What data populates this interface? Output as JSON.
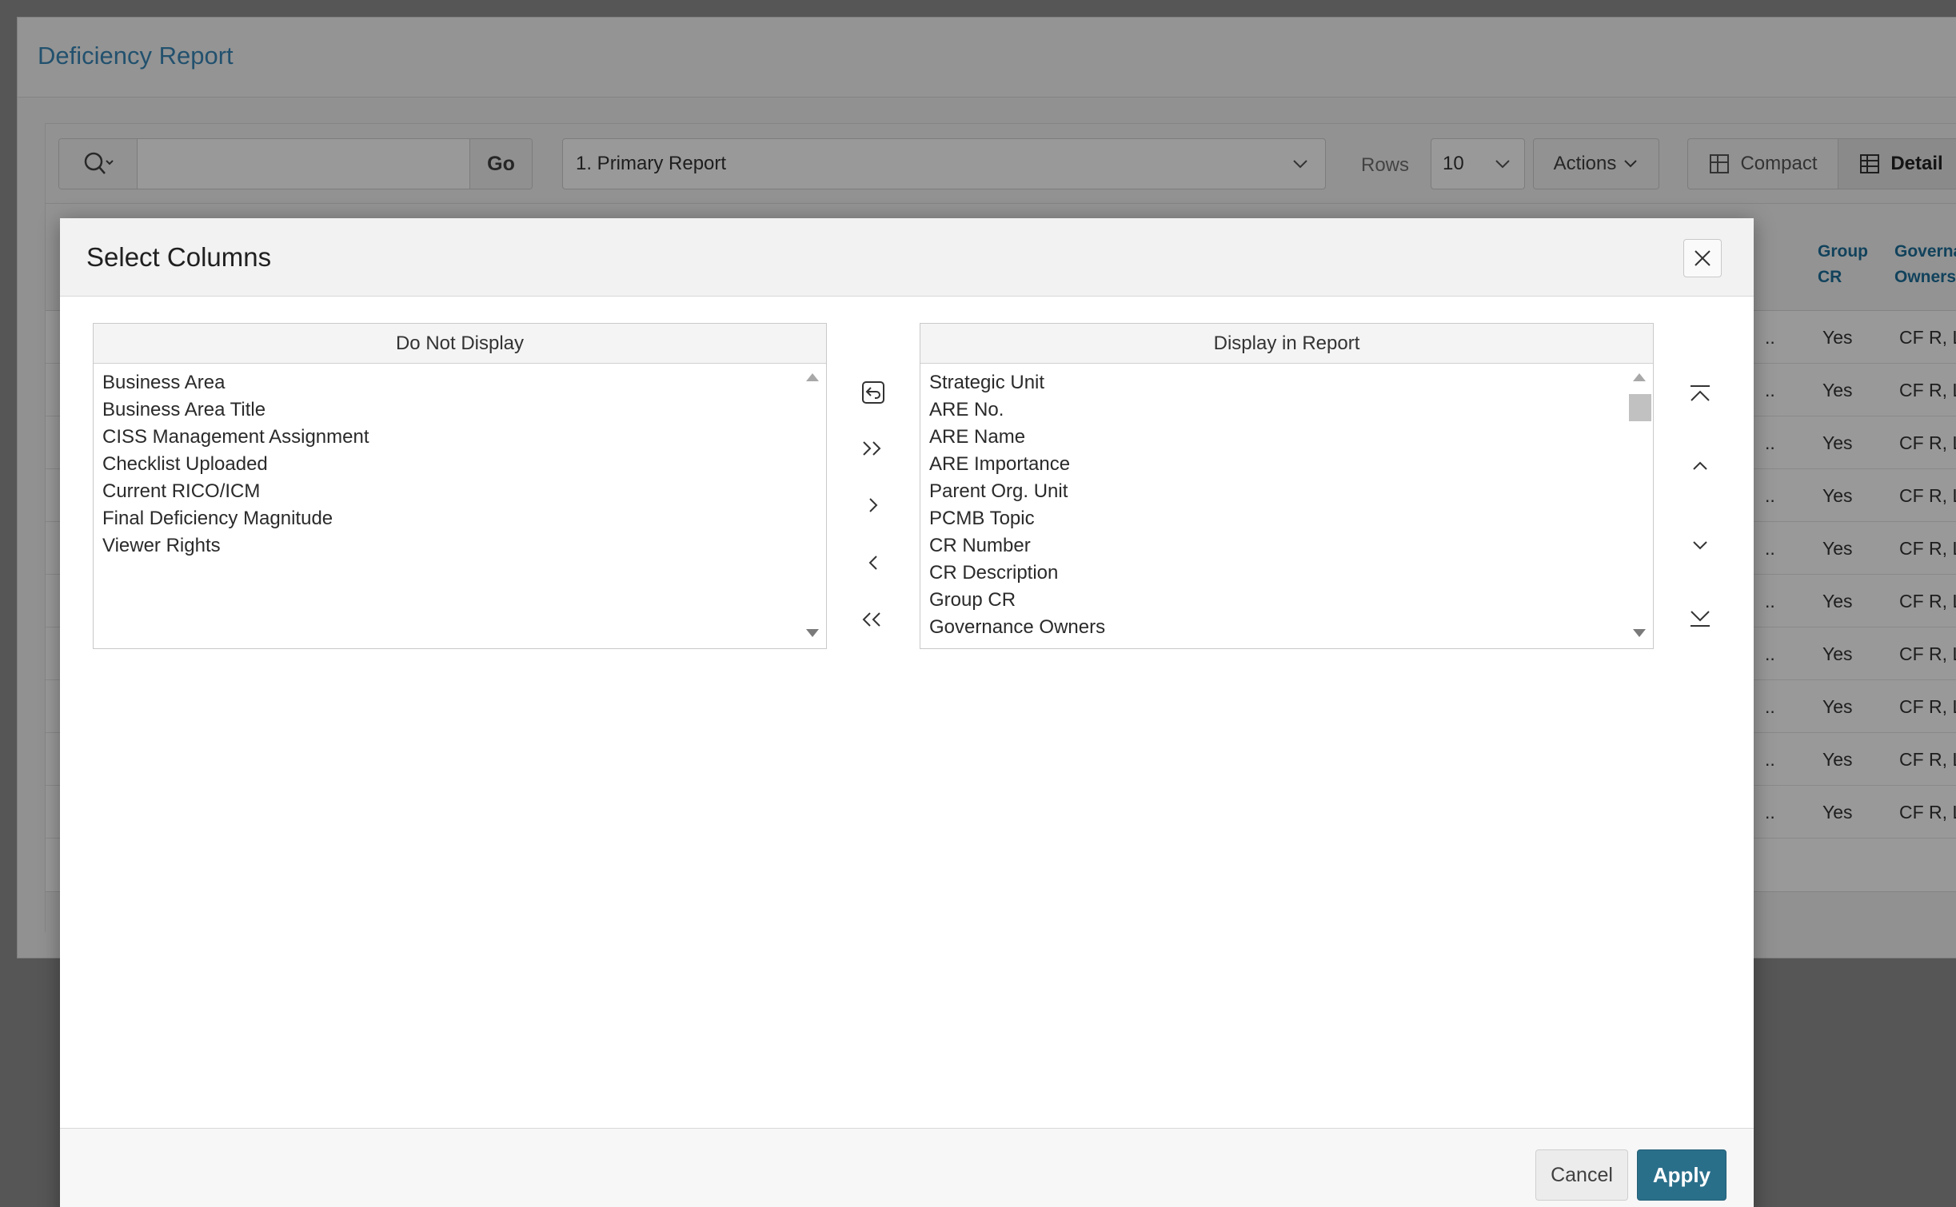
{
  "page": {
    "title": "Deficiency Report"
  },
  "toolbar": {
    "search_placeholder": "",
    "go_label": "Go",
    "report_selected": "1. Primary Report",
    "rows_label": "Rows",
    "rows_value": "10",
    "actions_label": "Actions",
    "view_compact_label": "Compact",
    "view_detail_label": "Detail"
  },
  "grid": {
    "visible_headers": [
      "Group CR",
      "Governance Owners"
    ],
    "header_group_cr": [
      "Group",
      "CR"
    ],
    "header_governance": [
      "Governance",
      "Owners"
    ],
    "rows": [
      {
        "truncated": "..",
        "group_cr": "Yes",
        "governance_owners": "CF R, LC"
      },
      {
        "truncated": "..",
        "group_cr": "Yes",
        "governance_owners": "CF R, LC"
      },
      {
        "truncated": "..",
        "group_cr": "Yes",
        "governance_owners": "CF R, LC"
      },
      {
        "truncated": "..",
        "group_cr": "Yes",
        "governance_owners": "CF R, LC"
      },
      {
        "truncated": "..",
        "group_cr": "Yes",
        "governance_owners": "CF R, LC"
      },
      {
        "truncated": "..",
        "group_cr": "Yes",
        "governance_owners": "CF R, LC"
      },
      {
        "truncated": "..",
        "group_cr": "Yes",
        "governance_owners": "CF R, LC"
      },
      {
        "truncated": "..",
        "group_cr": "Yes",
        "governance_owners": "CF R, LC"
      },
      {
        "truncated": "..",
        "group_cr": "Yes",
        "governance_owners": "CF R, LC"
      },
      {
        "truncated": "..",
        "group_cr": "Yes",
        "governance_owners": "CF R, LC"
      }
    ]
  },
  "dialog": {
    "title": "Select Columns",
    "do_not_display_header": "Do Not Display",
    "display_in_report_header": "Display in Report",
    "do_not_display_items": [
      "Business Area",
      "Business Area Title",
      "CISS Management Assignment",
      "Checklist Uploaded",
      "Current RICO/ICM",
      "Final Deficiency Magnitude",
      "Viewer Rights"
    ],
    "display_in_report_items": [
      "Strategic Unit",
      "ARE No.",
      "ARE Name",
      "ARE Importance",
      "Parent Org. Unit",
      "PCMB Topic",
      "CR Number",
      "CR Description",
      "Group CR",
      "Governance Owners"
    ],
    "cancel_label": "Cancel",
    "apply_label": "Apply"
  },
  "colors": {
    "accent": "#2a6f8a",
    "link_blue": "#3a88b8",
    "header_blue": "#1d6f9a"
  },
  "icons": {
    "search": "search-icon",
    "close": "close-icon",
    "reset": "reset-icon",
    "move_all_right": "double-chevron-right-icon",
    "move_right": "chevron-right-icon",
    "move_left": "chevron-left-icon",
    "move_all_left": "double-chevron-left-icon",
    "move_top": "move-top-icon",
    "move_up": "chevron-up-icon",
    "move_down": "chevron-down-icon",
    "move_bottom": "move-bottom-icon"
  }
}
